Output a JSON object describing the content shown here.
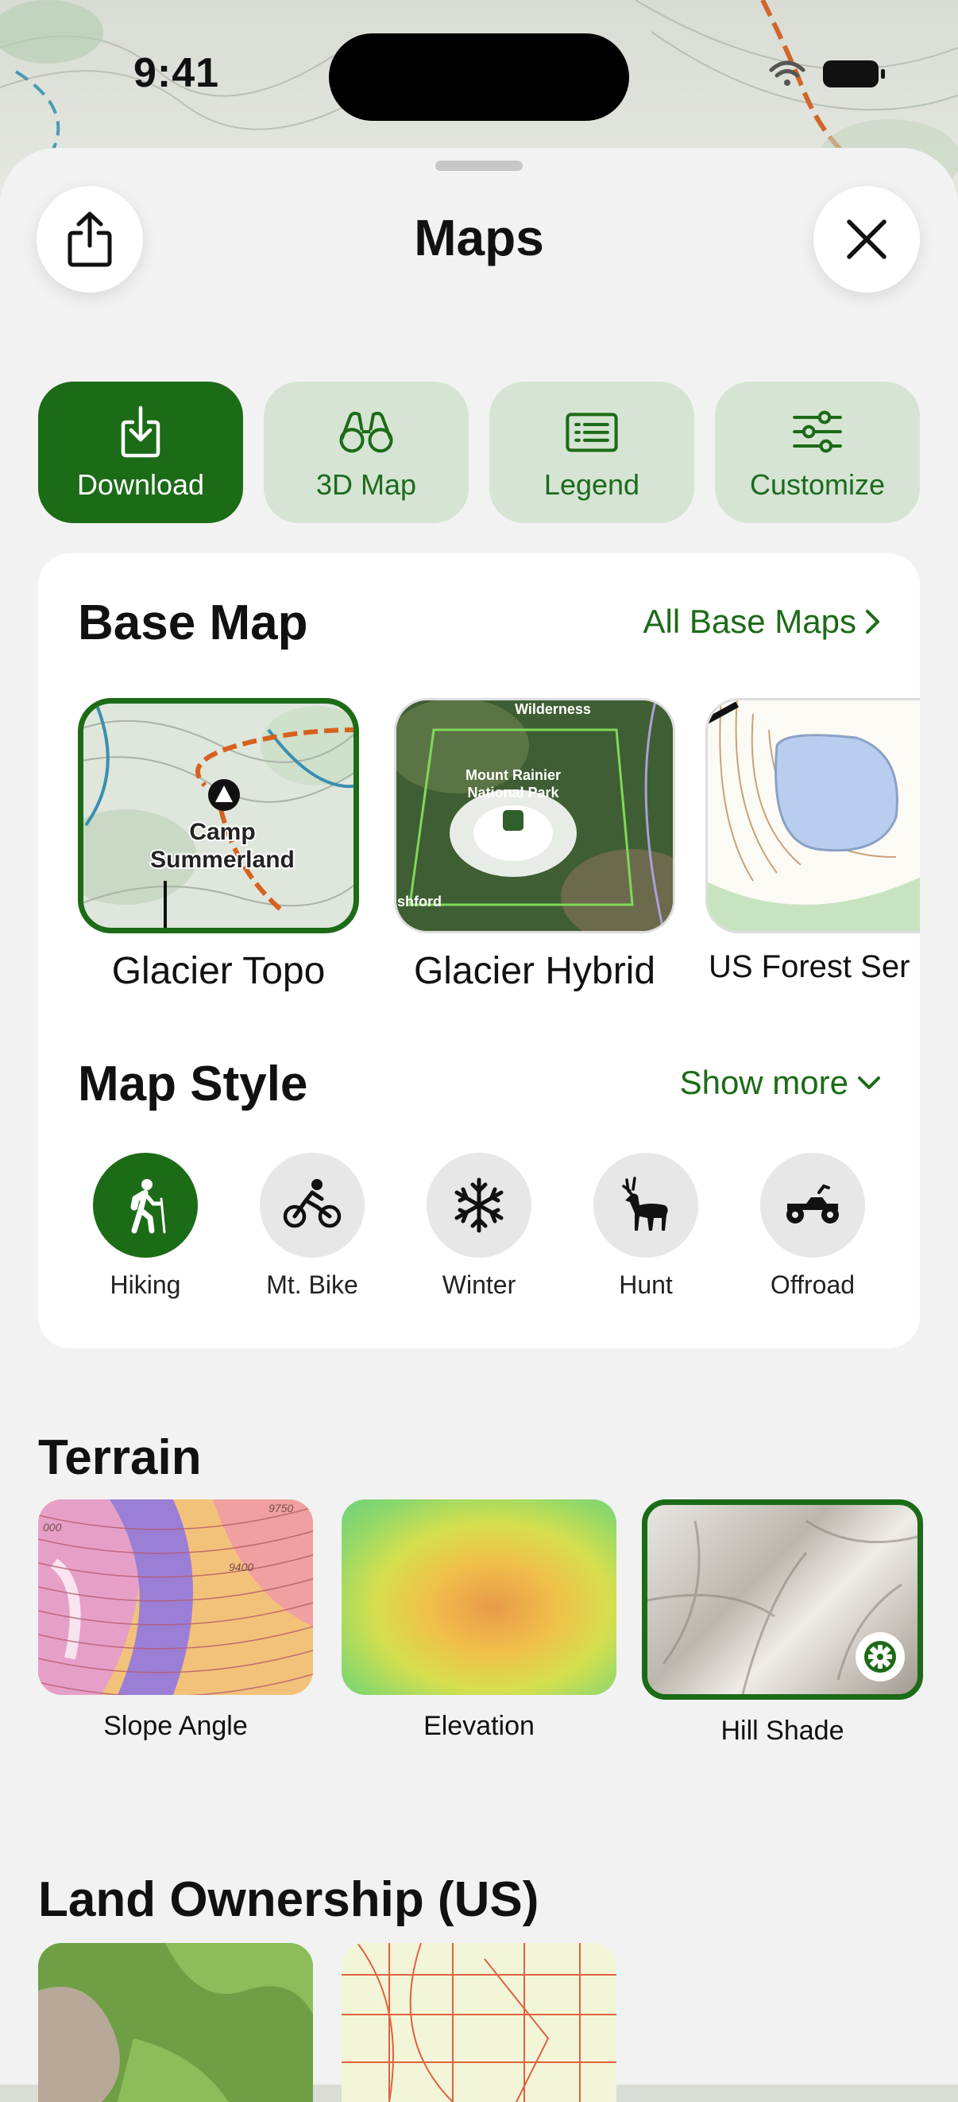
{
  "status": {
    "time": "9:41"
  },
  "sheet": {
    "title": "Maps"
  },
  "actions": [
    {
      "label": "Download",
      "icon": "download-icon",
      "active": true
    },
    {
      "label": "3D Map",
      "icon": "binoculars-icon",
      "active": false
    },
    {
      "label": "Legend",
      "icon": "legend-icon",
      "active": false
    },
    {
      "label": "Customize",
      "icon": "sliders-icon",
      "active": false
    }
  ],
  "base_map": {
    "title": "Base Map",
    "link_label": "All Base Maps",
    "items": [
      {
        "label": "Glacier Topo",
        "selected": true,
        "map_text": [
          "Camp",
          "Summerland"
        ]
      },
      {
        "label": "Glacier Hybrid",
        "selected": false,
        "map_text": [
          "Wilderness",
          "Mount Rainier",
          "National Park",
          "shford"
        ]
      },
      {
        "label": "US Forest Ser",
        "selected": false
      }
    ]
  },
  "map_style": {
    "title": "Map Style",
    "link_label": "Show more",
    "items": [
      {
        "label": "Hiking",
        "icon": "hiker-icon",
        "active": true
      },
      {
        "label": "Mt. Bike",
        "icon": "mountain-bike-icon",
        "active": false
      },
      {
        "label": "Winter",
        "icon": "snowflake-icon",
        "active": false
      },
      {
        "label": "Hunt",
        "icon": "deer-icon",
        "active": false
      },
      {
        "label": "Offroad",
        "icon": "atv-icon",
        "active": false
      }
    ]
  },
  "terrain": {
    "title": "Terrain",
    "items": [
      {
        "label": "Slope Angle",
        "selected": false,
        "map_text": [
          "9750",
          "9400",
          "000"
        ]
      },
      {
        "label": "Elevation",
        "selected": false
      },
      {
        "label": "Hill Shade",
        "selected": true
      }
    ]
  },
  "land_ownership": {
    "title": "Land Ownership (US)"
  },
  "colors": {
    "accent": "#1c6b17",
    "chip_bg": "#d6e4d4",
    "sheet_bg": "#f2f2f2"
  }
}
